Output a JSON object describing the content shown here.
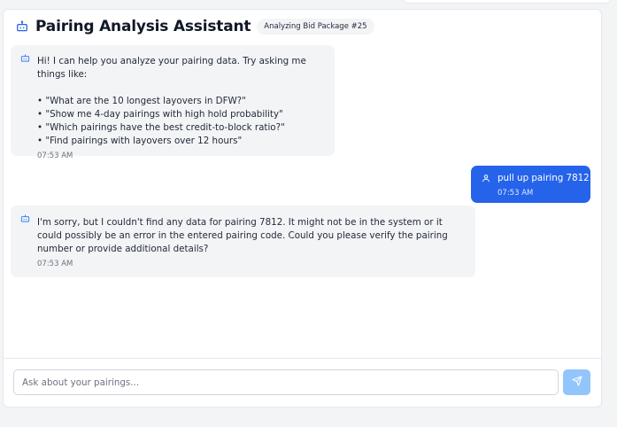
{
  "header": {
    "title": "Pairing Analysis Assistant",
    "badge": "Analyzing Bid Package #25",
    "icon": "bot-icon"
  },
  "messages": [
    {
      "role": "assistant",
      "intro": "Hi! I can help you analyze your pairing data. Try asking me things like:",
      "suggestions": [
        "\"What are the 10 longest layovers in DFW?\"",
        "\"Show me 4-day pairings with high hold probability\"",
        "\"Which pairings have the best credit-to-block ratio?\"",
        "\"Find pairings with layovers over 12 hours\""
      ],
      "time": "07:53 AM"
    },
    {
      "role": "user",
      "text": "pull up pairing 7812",
      "time": "07:53 AM"
    },
    {
      "role": "assistant",
      "text": "I'm sorry, but I couldn't find any data for pairing 7812. It might not be in the system or it could possibly be an error in the entered pairing code. Could you please verify the pairing number or provide additional details?",
      "time": "07:53 AM"
    }
  ],
  "composer": {
    "placeholder": "Ask about your pairings...",
    "send_icon": "send-icon"
  },
  "colors": {
    "accent": "#2563eb",
    "send_disabled": "#93c5fd",
    "bubble_bot": "#f3f4f6"
  }
}
